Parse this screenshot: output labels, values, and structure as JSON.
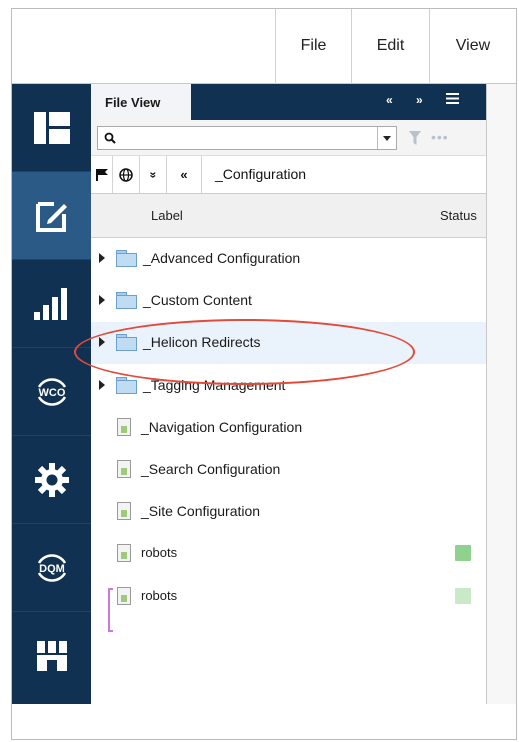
{
  "menu": {
    "file": "File",
    "edit": "Edit",
    "view": "View"
  },
  "panel": {
    "tab_label": "File View",
    "search_value": "",
    "breadcrumb": "_Configuration",
    "columns": {
      "label": "Label",
      "status": "Status"
    }
  },
  "tree": [
    {
      "label": "_Advanced Configuration",
      "kind": "folder"
    },
    {
      "label": "_Custom Content",
      "kind": "folder"
    },
    {
      "label": "_Helicon Redirects",
      "kind": "folder",
      "selected": true
    },
    {
      "label": "_Tagging Management",
      "kind": "folder"
    },
    {
      "label": "_Navigation Configuration",
      "kind": "file"
    },
    {
      "label": "_Search Configuration",
      "kind": "file"
    },
    {
      "label": "_Site Configuration",
      "kind": "file"
    },
    {
      "label": "robots",
      "kind": "file",
      "status_color": "#8fd18f"
    },
    {
      "label": "robots",
      "kind": "file",
      "status_color": "#c8eac8"
    }
  ],
  "rail_icons": [
    "layout-icon",
    "edit-icon",
    "analytics-icon",
    "wco-icon",
    "settings-icon",
    "dqm-icon",
    "marketplace-icon"
  ],
  "rail_text": {
    "wco": "WCO",
    "dqm": "DQM"
  },
  "colors": {
    "rail": "#103152",
    "rail_active": "#2c5a87",
    "highlight": "#e24a3a",
    "bracket": "#c97ad8"
  }
}
